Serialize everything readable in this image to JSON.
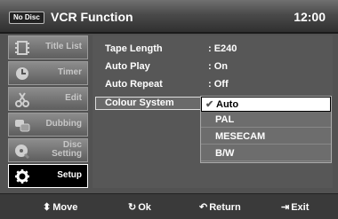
{
  "header": {
    "badge": "No Disc",
    "title": "VCR Function",
    "time": "12:00"
  },
  "sidebar": {
    "items": [
      {
        "label": "Title List",
        "icon": "film-icon"
      },
      {
        "label": "Timer",
        "icon": "clock-icon"
      },
      {
        "label": "Edit",
        "icon": "scissors-icon"
      },
      {
        "label": "Dubbing",
        "icon": "dubbing-icon"
      },
      {
        "label1": "Disc",
        "label2": "Setting",
        "icon": "disc-setting-icon"
      },
      {
        "label": "Setup",
        "icon": "gear-icon"
      }
    ]
  },
  "settings": [
    {
      "key": "Tape Length",
      "value": ": E240"
    },
    {
      "key": "Auto Play",
      "value": ": On"
    },
    {
      "key": "Auto Repeat",
      "value": ": Off"
    },
    {
      "key": "Colour System",
      "value": ""
    }
  ],
  "dropdown": {
    "options": [
      "Auto",
      "PAL",
      "MESECAM",
      "B/W"
    ],
    "selected_index": 0,
    "check_glyph": "✔"
  },
  "footer": {
    "move": {
      "glyph": "⬍",
      "label": "Move"
    },
    "ok": {
      "glyph": "↻",
      "label": "Ok"
    },
    "return": {
      "glyph": "↶",
      "label": "Return"
    },
    "exit": {
      "glyph": "⇥",
      "label": "Exit"
    }
  }
}
